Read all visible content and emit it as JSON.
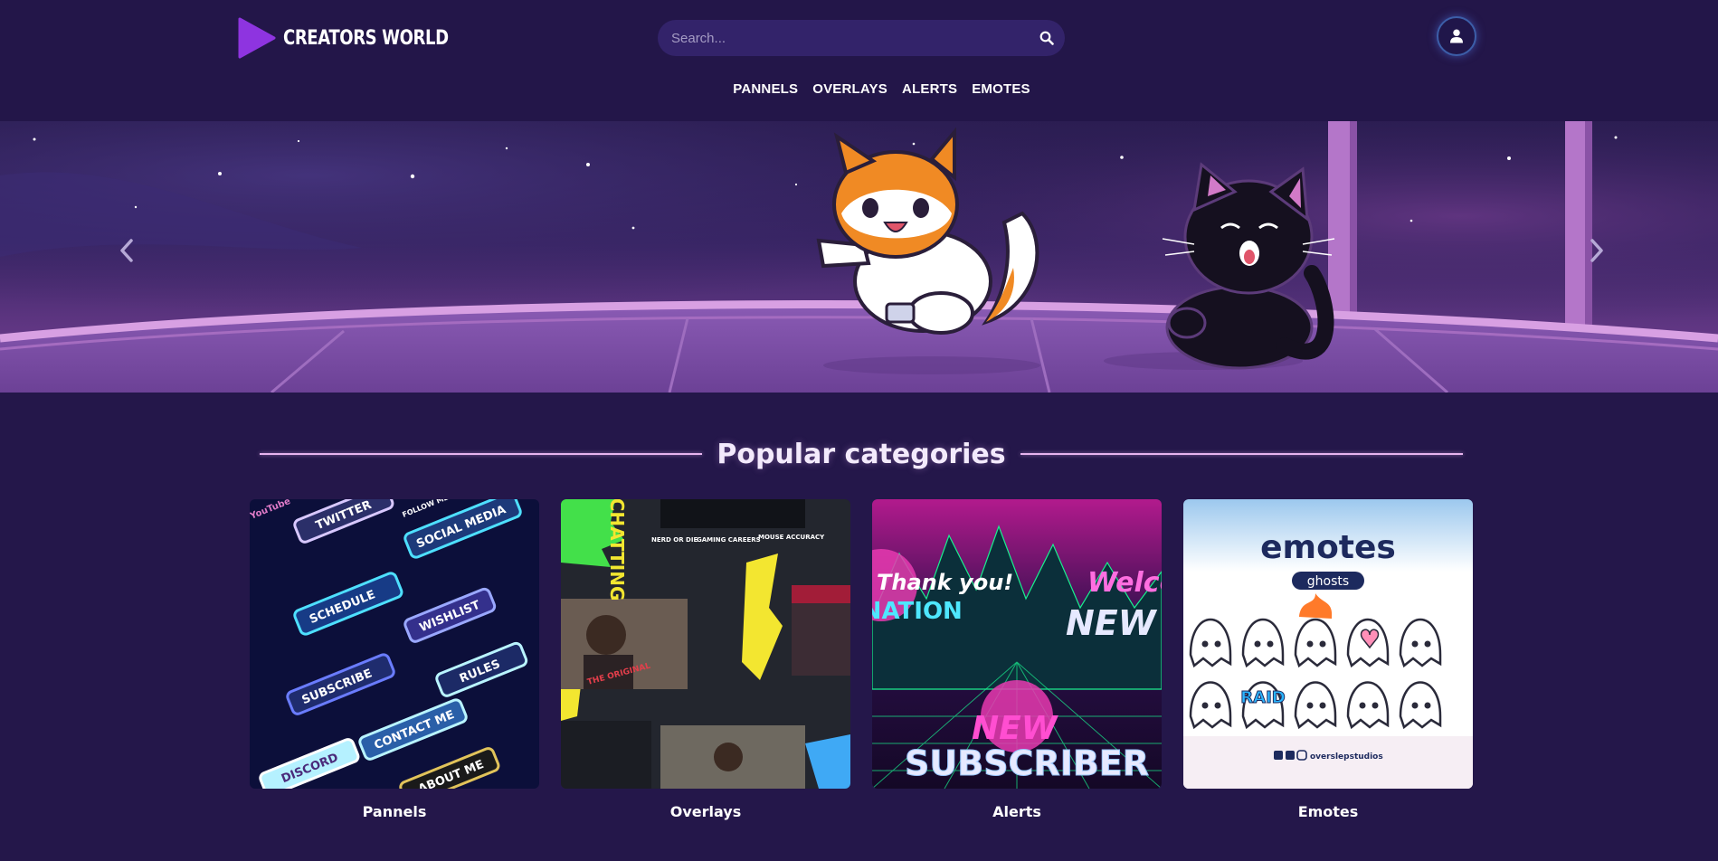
{
  "header": {
    "logo_text": "CREATORS WORLD",
    "search_placeholder": "Search...",
    "nav": [
      "PANNELS",
      "OVERLAYS",
      "ALERTS",
      "EMOTES"
    ]
  },
  "hero": {
    "icons": {
      "prev": "chevron-left-icon",
      "next": "chevron-right-icon"
    }
  },
  "categories": {
    "title": "Popular categories",
    "items": [
      {
        "label": "Pannels",
        "image_text": [
          "TWITTER",
          "SOCIAL MEDIA",
          "SCHEDULE",
          "WISHLIST",
          "SUBSCRIBE",
          "RULES",
          "CONTACT ME",
          "DISCORD",
          "ABOUT ME",
          "FOLLOW ME",
          "YouTube"
        ]
      },
      {
        "label": "Overlays",
        "image_text": [
          "JUST CHATTING",
          "NERD OR DIE",
          "GAMING CAREERS",
          "MOUSE ACCURACY",
          "THE ORIGINAL"
        ]
      },
      {
        "label": "Alerts",
        "image_text": [
          "Thank you!",
          "DONATION",
          "Welcome",
          "NEW",
          "NEW",
          "SUBSCRIBER"
        ]
      },
      {
        "label": "Emotes",
        "image_text": [
          "emotes",
          "ghosts",
          "RAID",
          "overslepstudios"
        ]
      }
    ]
  },
  "colors": {
    "background": "#24174a",
    "header": "#231649",
    "search_bg": "#33236a",
    "accent_purple": "#8e34e0",
    "title_line": "#e7b4ef"
  }
}
